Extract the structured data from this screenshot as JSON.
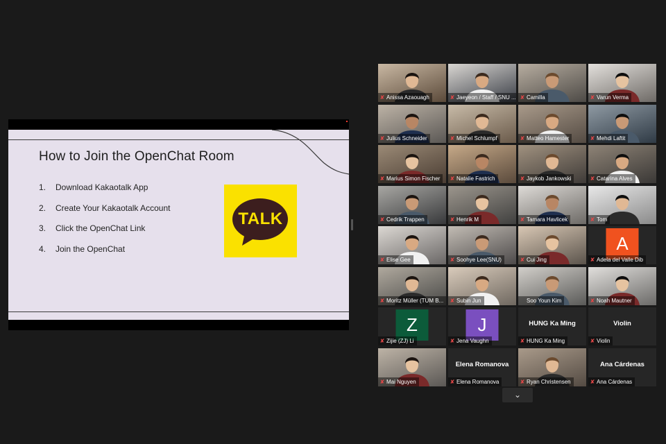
{
  "slide": {
    "title": "How to Join the OpenChat Room",
    "steps": [
      {
        "num": "1.",
        "text": "Download Kakaotalk App"
      },
      {
        "num": "2.",
        "text": "Create Your Kakaotalk Account"
      },
      {
        "num": "3.",
        "text": "Click the OpenChat Link"
      },
      {
        "num": "4.",
        "text": "Join the OpenChat"
      }
    ],
    "logo_text": "TALK",
    "logo_color": "#fae100",
    "logo_bubble_color": "#3c1e1e"
  },
  "gallery": {
    "participants": [
      {
        "name": "Anissa Azaouagh",
        "muted": true
      },
      {
        "name": "Jaeyeon / Staff / SNU ...",
        "muted": true
      },
      {
        "name": "Camilla",
        "muted": true
      },
      {
        "name": "Varun Verma",
        "muted": true
      },
      {
        "name": "Julius Schneider",
        "muted": true
      },
      {
        "name": "Michel Schlumpf",
        "muted": true
      },
      {
        "name": "Matteo Hamester",
        "muted": true
      },
      {
        "name": "Mehdi Laftit",
        "muted": true
      },
      {
        "name": "Marius Simon Fischer",
        "muted": true
      },
      {
        "name": "Natalie Fastrich",
        "muted": true
      },
      {
        "name": "Jaykob Jankowski",
        "muted": true
      },
      {
        "name": "Catarina Alves",
        "muted": true
      },
      {
        "name": "Cedrik Trappen",
        "muted": true
      },
      {
        "name": "Henrik M",
        "muted": true
      },
      {
        "name": "Tamara Havlicek",
        "muted": true
      },
      {
        "name": "Tom",
        "muted": true
      },
      {
        "name": "Elise Gee",
        "muted": true
      },
      {
        "name": "Soohye Lee(SNU)",
        "muted": true
      },
      {
        "name": "Cui Jing",
        "muted": true
      },
      {
        "name": "Adela del Valle Dib",
        "muted": true,
        "avatar_letter": "A",
        "avatar_color": "#f0521f"
      },
      {
        "name": "Moritz Müller (TUM B...",
        "muted": true
      },
      {
        "name": "Subin Jun",
        "muted": true
      },
      {
        "name": "Soo Youn Kim",
        "muted": false,
        "active": true
      },
      {
        "name": "Noah Mautner",
        "muted": true
      },
      {
        "name": "Zijie (ZJ) Li",
        "muted": true,
        "avatar_letter": "Z",
        "avatar_color": "#0c5b3a"
      },
      {
        "name": "Jena Vaughn",
        "muted": true,
        "avatar_letter": "J",
        "avatar_color": "#7a4fbf"
      },
      {
        "name": "HUNG Ka Ming",
        "muted": true,
        "display_name": "HUNG Ka Ming"
      },
      {
        "name": "Violin",
        "muted": true,
        "display_name": "Violin"
      },
      {
        "name": "Mai Nguyen",
        "muted": true
      },
      {
        "name": "Elena Romanova",
        "muted": true,
        "display_name": "Elena Romanova"
      },
      {
        "name": "Ryan Christensen",
        "muted": true
      },
      {
        "name": "Ana Cárdenas",
        "muted": true,
        "display_name": "Ana Cárdenas"
      }
    ],
    "next_page_icon": "chevron-down-icon"
  },
  "colors": {
    "background": "#1a1a1a",
    "active_speaker": "#d7e84b",
    "muted_icon": "#e54848"
  }
}
